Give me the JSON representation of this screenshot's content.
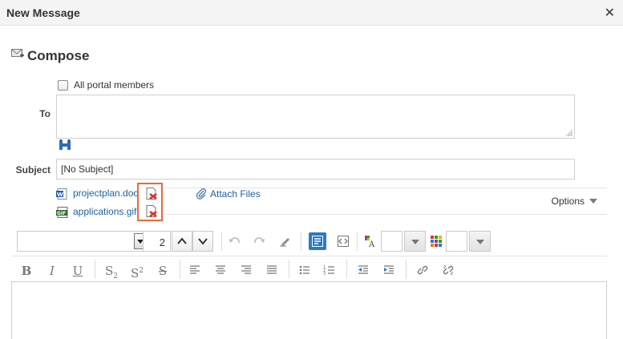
{
  "window": {
    "title": "New Message",
    "close_symbol": "✕"
  },
  "compose": {
    "heading": "Compose"
  },
  "form": {
    "all_members_label": "All portal members",
    "all_members_checked": false,
    "to_label": "To",
    "to_value": "",
    "subject_label": "Subject",
    "subject_value": "[No Subject]"
  },
  "attachments": [
    {
      "name": "projectplan.doc",
      "icon": "word-doc-icon"
    },
    {
      "name": "applications.gif",
      "icon": "gif-image-icon"
    }
  ],
  "attach_files_label": "Attach Files",
  "options_label": "Options",
  "toolbar": {
    "font_family_value": "",
    "font_size_value": "2"
  },
  "colors": {
    "link": "#1f5f9e",
    "highlight_border": "#e9693a",
    "active_button": "#2a79c7",
    "delete_icon": "#d8332a"
  }
}
